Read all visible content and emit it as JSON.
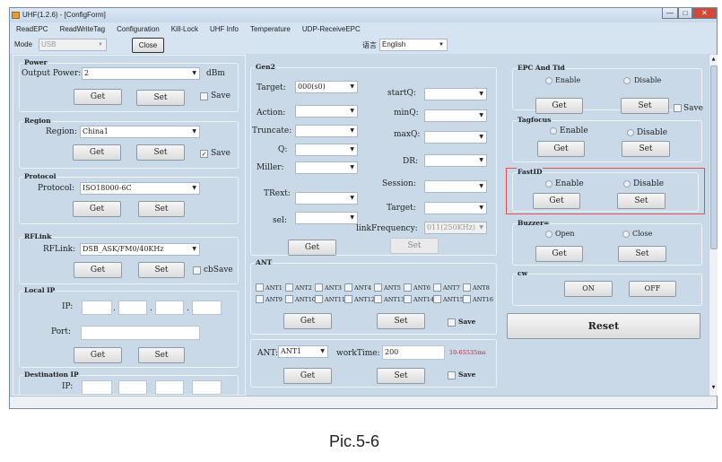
{
  "window": {
    "title": "UHF(1.2.6) - [ConfigForm]",
    "minimize": "—",
    "maximize": "□",
    "close": "✕"
  },
  "menu": [
    "ReadEPC",
    "ReadWriteTag",
    "Configuration",
    "Kill-Lock",
    "UHF Info",
    "Temperature",
    "UDP-ReceiveEPC"
  ],
  "toolbar": {
    "mode_label": "Mode",
    "mode_value": "USB",
    "close_button": "Close",
    "language_label": "语言",
    "language_value": "English"
  },
  "power": {
    "title": "Power",
    "label": "Output Power:",
    "value": "2",
    "unit": "dBm",
    "get": "Get",
    "set": "Set",
    "save": "Save",
    "save_checked": false
  },
  "region": {
    "title": "Region",
    "label": "Region:",
    "value": "China1",
    "get": "Get",
    "set": "Set",
    "save": "Save",
    "save_checked": true
  },
  "protocol": {
    "title": "Protocol",
    "label": "Protocol:",
    "value": "ISO18000-6C",
    "get": "Get",
    "set": "Set"
  },
  "rflink": {
    "title": "RFLink",
    "label": "RFLink:",
    "value": "DSB_ASK/FM0/40KHz",
    "get": "Get",
    "set": "Set",
    "save": "cbSave",
    "save_checked": false
  },
  "local_ip": {
    "title": "Local IP",
    "ip_label": "IP:",
    "port_label": "Port:",
    "get": "Get",
    "set": "Set",
    "dot": "."
  },
  "dest_ip": {
    "title": "Destination IP",
    "ip_label": "IP:"
  },
  "gen2": {
    "title": "Gen2",
    "target": "Target:",
    "target_value": "000(s0)",
    "action": "Action:",
    "truncate": "Truncate:",
    "q": "Q:",
    "miller": "Miller:",
    "trext": "TRext:",
    "sel": "sel:",
    "startq": "startQ:",
    "minq": "minQ:",
    "maxq": "maxQ:",
    "dr": "DR:",
    "session": "Session:",
    "target2": "Target:",
    "linkfreq": "linkFrequency:",
    "linkfreq_value": "011(250KHz)",
    "get": "Get",
    "set": "Set"
  },
  "ant": {
    "title": "ANT",
    "items": [
      "ANT1",
      "ANT2",
      "ANT3",
      "ANT4",
      "ANT5",
      "ANT6",
      "ANT7",
      "ANT8",
      "ANT9",
      "ANT10",
      "ANT11",
      "ANT12",
      "ANT13",
      "ANT14",
      "ANT15",
      "ANT16"
    ],
    "get": "Get",
    "set": "Set",
    "save": "Save"
  },
  "worktime": {
    "ant_label": "ANT:",
    "ant_value": "ANT1",
    "label": "workTime:",
    "value": "200",
    "range": "10-65535ms",
    "range_color": "#a03040",
    "get": "Get",
    "set": "Set",
    "save": "Save"
  },
  "epc_tid": {
    "title": "EPC And Tid",
    "enable": "Enable",
    "disable": "Disable",
    "get": "Get",
    "set": "Set",
    "save": "Save"
  },
  "tagfocus": {
    "title": "Tagfocus",
    "enable": "Enable",
    "disable": "Disable",
    "get": "Get",
    "set": "Set"
  },
  "fastid": {
    "title": "FastID",
    "enable": "Enable",
    "disable": "Disable",
    "get": "Get",
    "set": "Set",
    "highlight_color": "#e05050"
  },
  "buzzer": {
    "title": "Buzzer=",
    "open": "Open",
    "close": "Close",
    "get": "Get",
    "set": "Set"
  },
  "cw": {
    "title": "cw",
    "on": "ON",
    "off": "OFF"
  },
  "reset": "Reset",
  "caption": "Pic.5-6"
}
